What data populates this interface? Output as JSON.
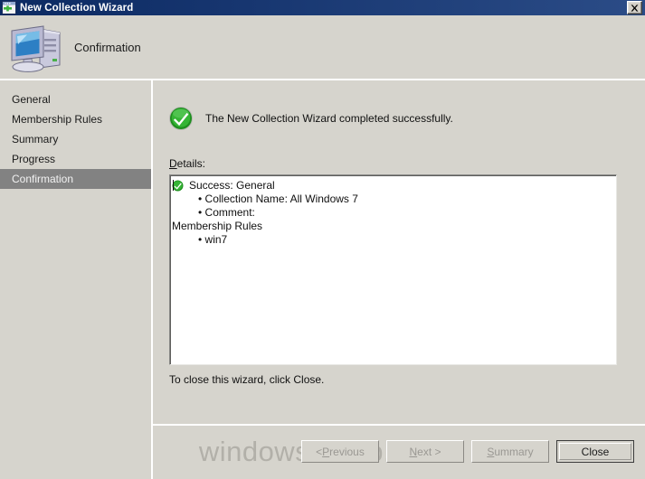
{
  "window": {
    "title": "New Collection Wizard",
    "icon": "new-window-icon",
    "close_label": "Close window"
  },
  "header": {
    "title": "Confirmation",
    "icon": "computer-icon"
  },
  "sidebar": {
    "items": [
      {
        "label": "General",
        "active": false
      },
      {
        "label": "Membership Rules",
        "active": false
      },
      {
        "label": "Summary",
        "active": false
      },
      {
        "label": "Progress",
        "active": false
      },
      {
        "label": "Confirmation",
        "active": true
      }
    ]
  },
  "main": {
    "success_icon": "green-check-circle-icon",
    "success_message": "The New Collection Wizard completed successfully.",
    "details_label_accesskey": "D",
    "details_label_rest": "etails:",
    "details": [
      {
        "type": "head",
        "text": "Success: General",
        "icon": "green-check-icon"
      },
      {
        "type": "bullet",
        "text": "• Collection Name: All Windows 7"
      },
      {
        "type": "bullet",
        "text": "• Comment:"
      },
      {
        "type": "plain",
        "text": "Membership Rules"
      },
      {
        "type": "bullet",
        "text": "• win7"
      }
    ],
    "close_hint": "To close this wizard, click Close."
  },
  "footer": {
    "watermark": "windows-noob.com",
    "buttons": [
      {
        "name": "previous-button",
        "prefix": "< ",
        "accesskey": "P",
        "suffix": "revious",
        "disabled": true,
        "default": false
      },
      {
        "name": "next-button",
        "prefix": "",
        "accesskey": "N",
        "suffix": "ext >",
        "disabled": true,
        "default": false
      },
      {
        "name": "summary-button",
        "prefix": "",
        "accesskey": "S",
        "suffix": "ummary",
        "disabled": true,
        "default": false
      },
      {
        "name": "close-button",
        "prefix": "",
        "accesskey": "",
        "suffix": "Close",
        "disabled": false,
        "default": true
      }
    ]
  },
  "colors": {
    "titlebar_start": "#0c2a62",
    "titlebar_end": "#2b4c87",
    "dialog_face": "#d6d4cd",
    "selection": "#828282",
    "success_green": "#2faa2f",
    "watermark": "#b2b0a9"
  }
}
